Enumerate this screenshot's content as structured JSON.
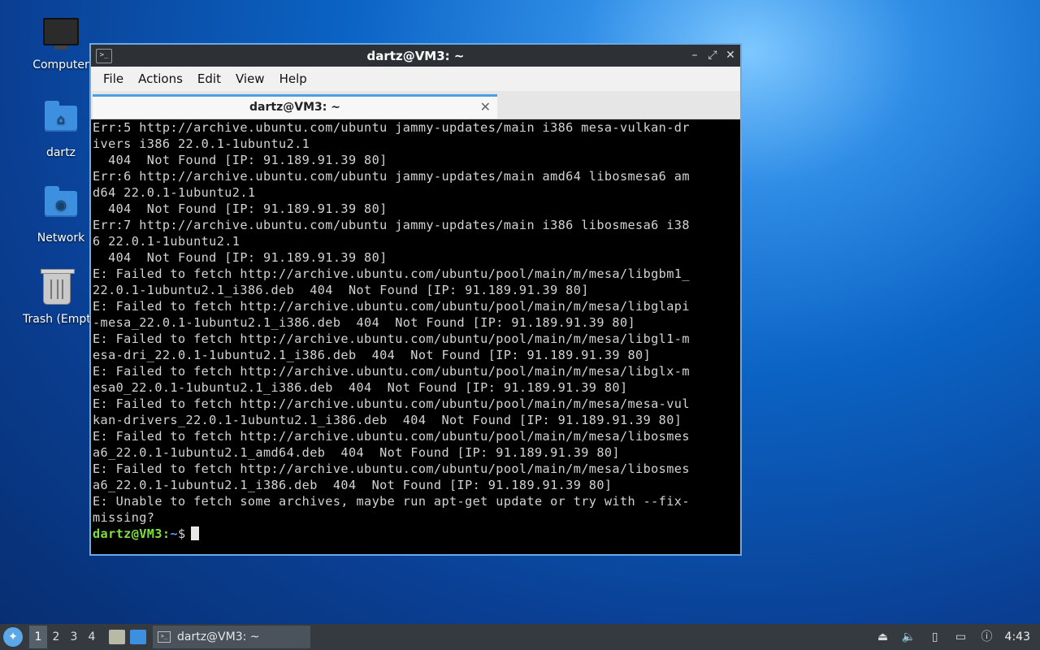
{
  "desktop": {
    "icons": [
      {
        "label": "Computer",
        "icon": "computer-icon"
      },
      {
        "label": "dartz",
        "icon": "home-folder-icon"
      },
      {
        "label": "Network",
        "icon": "network-folder-icon"
      },
      {
        "label": "Trash (Empty)",
        "icon": "trash-icon"
      }
    ]
  },
  "window": {
    "title": "dartz@VM3: ~",
    "menu": [
      "File",
      "Actions",
      "Edit",
      "View",
      "Help"
    ],
    "tab_title": "dartz@VM3: ~",
    "controls": {
      "minimize": "–",
      "maximize": "⤢",
      "close": "✕"
    }
  },
  "terminal": {
    "lines": [
      "Err:5 http://archive.ubuntu.com/ubuntu jammy-updates/main i386 mesa-vulkan-dr",
      "ivers i386 22.0.1-1ubuntu2.1",
      "  404  Not Found [IP: 91.189.91.39 80]",
      "Err:6 http://archive.ubuntu.com/ubuntu jammy-updates/main amd64 libosmesa6 am",
      "d64 22.0.1-1ubuntu2.1",
      "  404  Not Found [IP: 91.189.91.39 80]",
      "Err:7 http://archive.ubuntu.com/ubuntu jammy-updates/main i386 libosmesa6 i38",
      "6 22.0.1-1ubuntu2.1",
      "  404  Not Found [IP: 91.189.91.39 80]",
      "E: Failed to fetch http://archive.ubuntu.com/ubuntu/pool/main/m/mesa/libgbm1_",
      "22.0.1-1ubuntu2.1_i386.deb  404  Not Found [IP: 91.189.91.39 80]",
      "E: Failed to fetch http://archive.ubuntu.com/ubuntu/pool/main/m/mesa/libglapi",
      "-mesa_22.0.1-1ubuntu2.1_i386.deb  404  Not Found [IP: 91.189.91.39 80]",
      "E: Failed to fetch http://archive.ubuntu.com/ubuntu/pool/main/m/mesa/libgl1-m",
      "esa-dri_22.0.1-1ubuntu2.1_i386.deb  404  Not Found [IP: 91.189.91.39 80]",
      "E: Failed to fetch http://archive.ubuntu.com/ubuntu/pool/main/m/mesa/libglx-m",
      "esa0_22.0.1-1ubuntu2.1_i386.deb  404  Not Found [IP: 91.189.91.39 80]",
      "E: Failed to fetch http://archive.ubuntu.com/ubuntu/pool/main/m/mesa/mesa-vul",
      "kan-drivers_22.0.1-1ubuntu2.1_i386.deb  404  Not Found [IP: 91.189.91.39 80]",
      "E: Failed to fetch http://archive.ubuntu.com/ubuntu/pool/main/m/mesa/libosmes",
      "a6_22.0.1-1ubuntu2.1_amd64.deb  404  Not Found [IP: 91.189.91.39 80]",
      "E: Failed to fetch http://archive.ubuntu.com/ubuntu/pool/main/m/mesa/libosmes",
      "a6_22.0.1-1ubuntu2.1_i386.deb  404  Not Found [IP: 91.189.91.39 80]",
      "E: Unable to fetch some archives, maybe run apt-get update or try with --fix-",
      "missing?"
    ],
    "prompt": {
      "user_host": "dartz@VM3",
      "sep": ":",
      "path": "~",
      "symbol": "$"
    }
  },
  "panel": {
    "workspaces": [
      "1",
      "2",
      "3",
      "4"
    ],
    "active_workspace": "1",
    "taskbar_item": "dartz@VM3: ~",
    "clock": "4:43"
  }
}
